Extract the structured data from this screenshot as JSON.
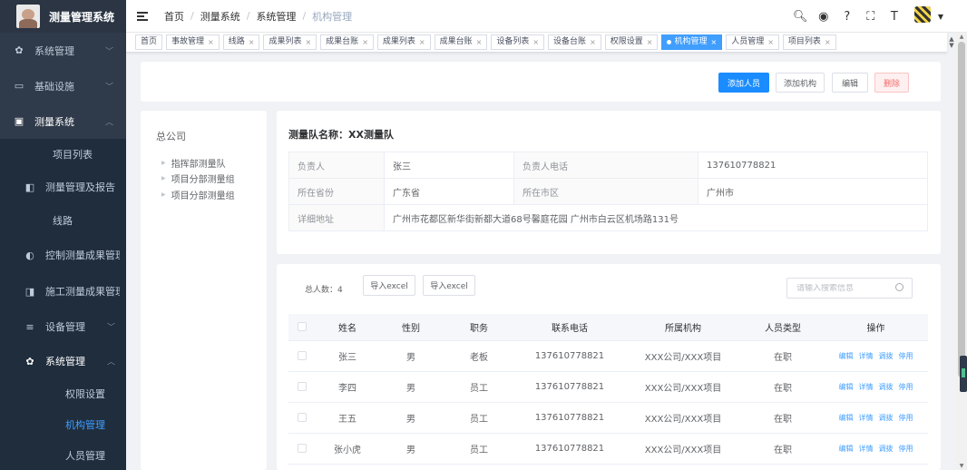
{
  "sidebar": {
    "logo_title": "测量管理系统",
    "items": [
      {
        "label": "系统管理",
        "icon": "gear-icon",
        "glyph": "✿"
      },
      {
        "label": "基础设施",
        "icon": "monitor-icon",
        "glyph": "▭"
      },
      {
        "label": "测量系统",
        "icon": "document-icon",
        "glyph": "▣"
      }
    ],
    "sub_project": "项目列表",
    "sub_report": "测量管理及报告",
    "sub_line": "线路",
    "control": "控制测量成果管理",
    "construct": "施工测量成果管理",
    "device": "设备管理",
    "sys_mgmt": "系统管理",
    "sys_children": [
      "权限设置",
      "机构管理",
      "人员管理"
    ]
  },
  "header": {
    "breadcrumb": [
      "首页",
      "测量系统",
      "系统管理",
      "机构管理"
    ]
  },
  "tags": [
    {
      "label": "首页",
      "closable": false,
      "active": false
    },
    {
      "label": "事故管理",
      "closable": true,
      "active": false
    },
    {
      "label": "线路",
      "closable": true,
      "active": false
    },
    {
      "label": "成果列表",
      "closable": true,
      "active": false
    },
    {
      "label": "成果台账",
      "closable": true,
      "active": false
    },
    {
      "label": "成果列表",
      "closable": true,
      "active": false
    },
    {
      "label": "成果台账",
      "closable": true,
      "active": false
    },
    {
      "label": "设备列表",
      "closable": true,
      "active": false
    },
    {
      "label": "设备台账",
      "closable": true,
      "active": false
    },
    {
      "label": "权限设置",
      "closable": true,
      "active": false
    },
    {
      "label": "机构管理",
      "closable": true,
      "active": true
    },
    {
      "label": "人员管理",
      "closable": true,
      "active": false
    },
    {
      "label": "项目列表",
      "closable": true,
      "active": false
    }
  ],
  "actions": {
    "add_person": "添加人员",
    "add_org": "添加机构",
    "edit": "编辑",
    "delete": "删除"
  },
  "tree": {
    "root": "总公司",
    "nodes": [
      "指挥部测量队",
      "项目分部测量组",
      "项目分部测量组"
    ]
  },
  "info": {
    "title_label": "测量队名称：",
    "title_value": "XX测量队",
    "leader_label": "负责人",
    "leader": "张三",
    "phone_label": "负责人电话",
    "phone": "137610778821",
    "province_label": "所在省份",
    "province": "广东省",
    "city_label": "所在市区",
    "city": "广州市",
    "address_label": "详细地址",
    "address": "广州市花都区新华街新都大道68号馨庭花园 广州市白云区机场路131号"
  },
  "list": {
    "total": "总人数：4",
    "import1": "导入excel",
    "import2": "导入excel",
    "search_placeholder": "请输入搜索信息",
    "columns": [
      "姓名",
      "性别",
      "职务",
      "联系电话",
      "所属机构",
      "人员类型",
      "操作"
    ],
    "rows": [
      {
        "name": "张三",
        "gender": "男",
        "title": "老板",
        "phone": "137610778821",
        "org": "XXX公司/XXX项目",
        "type": "在职"
      },
      {
        "name": "李四",
        "gender": "男",
        "title": "员工",
        "phone": "137610778821",
        "org": "XXX公司/XXX项目",
        "type": "在职"
      },
      {
        "name": "王五",
        "gender": "男",
        "title": "员工",
        "phone": "137610778821",
        "org": "XXX公司/XXX项目",
        "type": "在职"
      },
      {
        "name": "张小虎",
        "gender": "男",
        "title": "员工",
        "phone": "137610778821",
        "org": "XXX公司/XXX项目",
        "type": "在职"
      }
    ],
    "ops": [
      "编辑",
      "详情",
      "调拨",
      "停用"
    ]
  }
}
